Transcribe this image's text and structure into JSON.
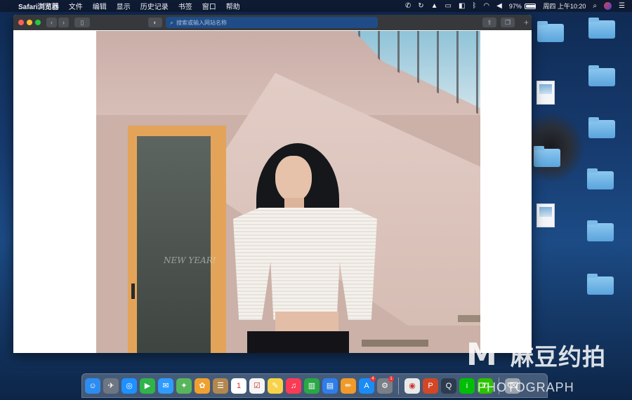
{
  "menubar": {
    "app_name": "Safari浏览器",
    "items": [
      "文件",
      "编辑",
      "显示",
      "历史记录",
      "书签",
      "窗口",
      "帮助"
    ],
    "battery": "97%",
    "battery_level": 0.97,
    "clock": "周四 上午10:20"
  },
  "safari": {
    "address_placeholder": "搜索或输入网站名称",
    "photo_text": "NEW YEAR!"
  },
  "desktop": {
    "icons": [
      "folder-icon",
      "folder-icon",
      "image-file-icon",
      "folder-icon",
      "folder-icon",
      "folder-icon",
      "image-file-icon",
      "folder-icon",
      "folder-icon"
    ]
  },
  "dock": {
    "apps": [
      {
        "name": "finder",
        "color": "#2d8cf0",
        "glyph": "☺"
      },
      {
        "name": "launchpad",
        "color": "#6e7683",
        "glyph": "✈"
      },
      {
        "name": "safari",
        "color": "#1e90ff",
        "glyph": "◎"
      },
      {
        "name": "facetime",
        "color": "#2fb34a",
        "glyph": "▶"
      },
      {
        "name": "messages",
        "color": "#2f9bff",
        "glyph": "✉"
      },
      {
        "name": "maps",
        "color": "#59b55c",
        "glyph": "✦"
      },
      {
        "name": "photos",
        "color": "#f0a030",
        "glyph": "✿"
      },
      {
        "name": "contacts",
        "color": "#b3884f",
        "glyph": "☰"
      },
      {
        "name": "calendar",
        "color": "#ffffff",
        "glyph": "1"
      },
      {
        "name": "reminders",
        "color": "#f5f5f5",
        "glyph": "☑"
      },
      {
        "name": "notes",
        "color": "#f7d34a",
        "glyph": "✎"
      },
      {
        "name": "music",
        "color": "#fa3b55",
        "glyph": "♫"
      },
      {
        "name": "numbers",
        "color": "#29a845",
        "glyph": "▥"
      },
      {
        "name": "keynote",
        "color": "#2f7ee8",
        "glyph": "▤"
      },
      {
        "name": "pages",
        "color": "#f09a2a",
        "glyph": "✏"
      },
      {
        "name": "app-store",
        "color": "#1a8cf5",
        "glyph": "A",
        "badge": "4"
      },
      {
        "name": "system-preferences",
        "color": "#7a7f88",
        "glyph": "⚙",
        "badge": "1"
      },
      {
        "name": "chrome",
        "color": "#e9e9e9",
        "glyph": "◉"
      },
      {
        "name": "powerpoint",
        "color": "#d24726",
        "glyph": "P"
      },
      {
        "name": "quicktime",
        "color": "#2d3b4e",
        "glyph": "Q"
      },
      {
        "name": "iqiyi",
        "color": "#00be06",
        "glyph": "i"
      },
      {
        "name": "wechat",
        "color": "#2dc100",
        "glyph": "✆"
      },
      {
        "name": "trash",
        "color": "#9aa3ad",
        "glyph": "⌫"
      }
    ]
  },
  "watermark": {
    "logo_letter": "M",
    "brand": "麻豆约拍",
    "brand_en": "PHOTOGRAPH"
  }
}
